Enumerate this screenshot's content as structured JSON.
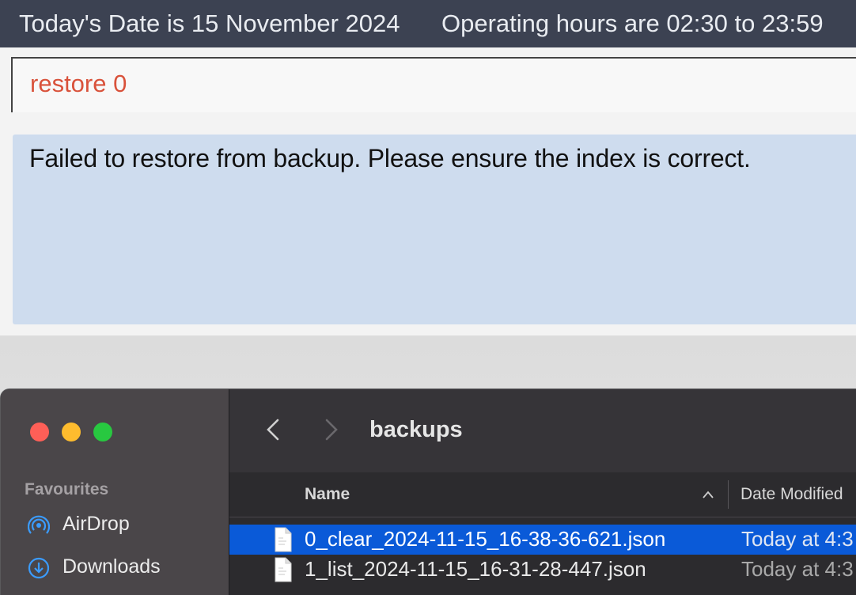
{
  "header": {
    "date_text": "Today's Date is 15 November 2024",
    "hours_text": "Operating hours are 02:30 to 23:59"
  },
  "command": {
    "value": "restore 0",
    "color": "#d9523b"
  },
  "result": {
    "message": "Failed to restore from backup. Please ensure the index is correct."
  },
  "finder": {
    "title": "backups",
    "sidebar": {
      "section": "Favourites",
      "items": [
        {
          "label": "AirDrop",
          "icon": "airdrop-icon"
        },
        {
          "label": "Downloads",
          "icon": "downloads-icon"
        }
      ]
    },
    "columns": {
      "name": "Name",
      "date_modified": "Date Modified"
    },
    "files": [
      {
        "name": "0_clear_2024-11-15_16-38-36-621.json",
        "date": "Today at 4:3",
        "selected": true
      },
      {
        "name": "1_list_2024-11-15_16-31-28-447.json",
        "date": "Today at 4:3",
        "selected": false
      }
    ],
    "colors": {
      "selection": "#0a5ad8",
      "traffic_red": "#fe5f57",
      "traffic_yellow": "#febc2e",
      "traffic_green": "#28c840"
    }
  }
}
